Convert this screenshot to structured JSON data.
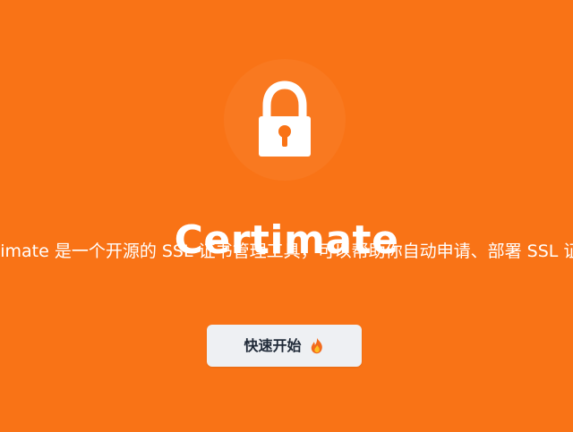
{
  "hero": {
    "title": "Certimate",
    "subtitle": "Certimate 是一个开源的 SSL 证书管理工具，可以帮助你自动申请、部署 SSL 证书，并在证书即将过期时自动续期。",
    "logo_icon": "lock-icon",
    "cta": {
      "label": "快速开始",
      "icon": "fire-icon"
    }
  },
  "colors": {
    "background": "#f97316",
    "text": "#ffffff",
    "button_bg": "#eef0f3",
    "button_text": "#1f2937",
    "flame_outer": "#f26b1d",
    "flame_inner": "#fbbf24"
  }
}
